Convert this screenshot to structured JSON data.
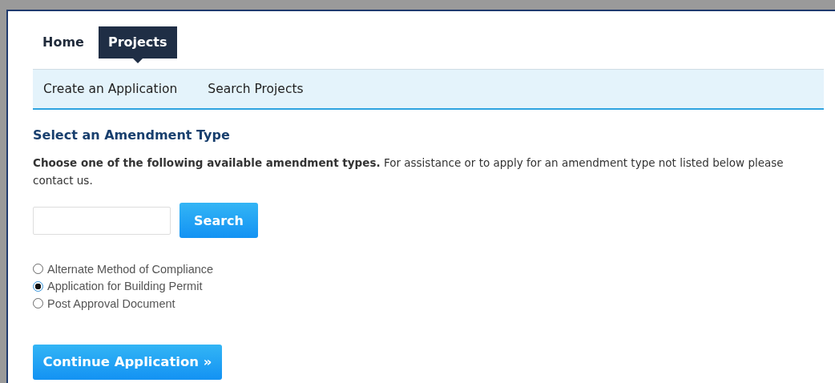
{
  "tabs": [
    {
      "label": "Home",
      "selected": false
    },
    {
      "label": "Projects",
      "selected": true
    }
  ],
  "subnav": [
    "Create an Application",
    "Search Projects"
  ],
  "heading": "Select an Amendment Type",
  "instructions": "**Choose one of the following available amendment types.** For assistance or to apply for an amendment type not listed below please contact us.",
  "search": {
    "button": "Search"
  },
  "options": [
    {
      "label": "Alternate Method of Compliance",
      "selected": false
    },
    {
      "label": "Application for Building Permit",
      "selected": true
    },
    {
      "label": "Post Approval Document",
      "selected": false
    }
  ],
  "continue_button": "Continue Application »"
}
